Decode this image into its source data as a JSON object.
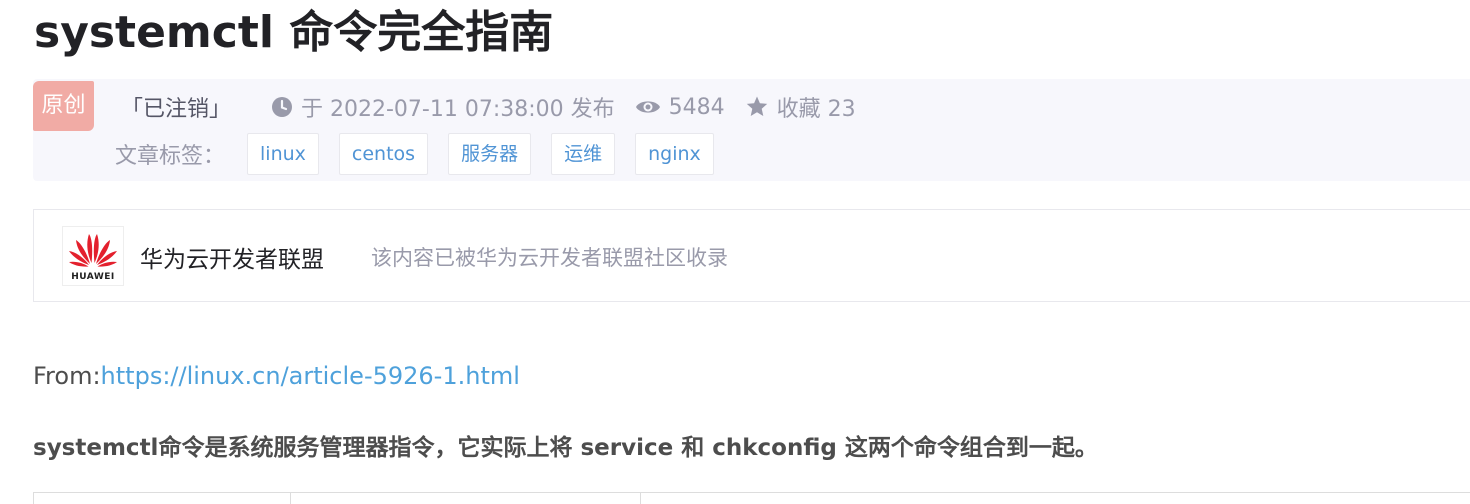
{
  "article": {
    "title": "systemctl 命令完全指南",
    "badge": "原创",
    "author": "「已注销」",
    "publish": "于 2022-07-11 07:38:00 发布",
    "views": "5484",
    "favorites": "收藏 23"
  },
  "tags": {
    "label": "文章标签：",
    "items": [
      "linux",
      "centos",
      "服务器",
      "运维",
      "nginx"
    ]
  },
  "community": {
    "logo_text": "HUAWEI",
    "name": "华为云开发者联盟",
    "desc": "该内容已被华为云开发者联盟社区收录"
  },
  "content": {
    "from_label": "From:",
    "from_url": "https://linux.cn/article-5926-1.html",
    "summary": "systemctl命令是系统服务管理器指令，它实际上将 service 和 chkconfig 这两个命令组合到一起。"
  },
  "colors": {
    "badge_bg": "#f1aba5",
    "link": "#4ea1db",
    "tag_text": "#5094d5",
    "meta_text": "#999aaa",
    "huawei_red": "#e3202d"
  },
  "icons": [
    "clock-icon",
    "eye-icon",
    "star-icon",
    "huawei-logo"
  ]
}
